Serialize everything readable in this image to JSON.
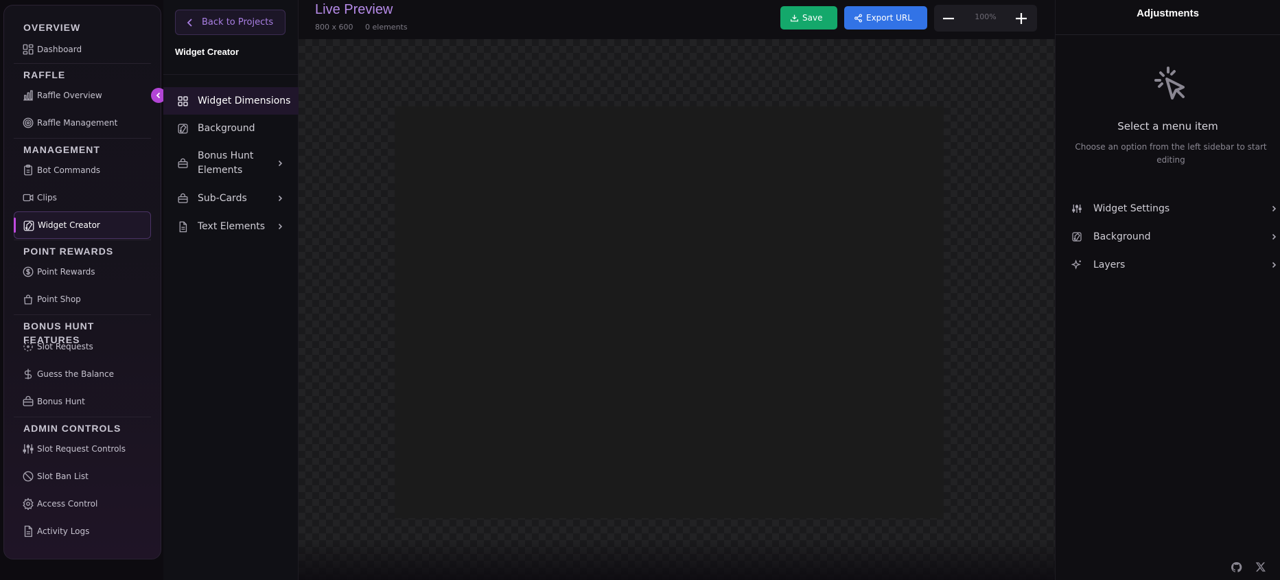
{
  "nav": {
    "sections": [
      {
        "title": "OVERVIEW",
        "items": [
          {
            "label": "Dashboard",
            "icon": "dashboard-icon"
          }
        ]
      },
      {
        "title": "RAFFLE",
        "items": [
          {
            "label": "Raffle Overview",
            "icon": "bar-chart-icon"
          },
          {
            "label": "Raffle Management",
            "icon": "target-icon"
          }
        ]
      },
      {
        "title": "MANAGEMENT",
        "items": [
          {
            "label": "Bot Commands",
            "icon": "clipboard-icon"
          },
          {
            "label": "Clips",
            "icon": "video-icon"
          },
          {
            "label": "Widget Creator",
            "icon": "palette-icon",
            "active": true
          }
        ]
      },
      {
        "title": "POINT REWARDS",
        "items": [
          {
            "label": "Point Rewards",
            "icon": "dollar-circle-icon"
          },
          {
            "label": "Point Shop",
            "icon": "shopping-bag-icon"
          }
        ]
      },
      {
        "title": "BONUS HUNT FEATURES",
        "items": [
          {
            "label": "Slot Requests",
            "icon": "dashed-circle-icon"
          },
          {
            "label": "Guess the Balance",
            "icon": "dollar-icon"
          },
          {
            "label": "Bonus Hunt",
            "icon": "briefcase-icon"
          }
        ]
      },
      {
        "title": "ADMIN CONTROLS",
        "items": [
          {
            "label": "Slot Request Controls",
            "icon": "sliders-icon"
          },
          {
            "label": "Slot Ban List",
            "icon": "ban-icon"
          },
          {
            "label": "Access Control",
            "icon": "gear-icon"
          },
          {
            "label": "Activity Logs",
            "icon": "file-icon"
          }
        ]
      }
    ]
  },
  "editor": {
    "back_label": "Back to Projects",
    "title": "Widget Creator",
    "items": [
      {
        "label": "Widget Dimensions",
        "icon": "grid-icon",
        "active": true,
        "chevron": false
      },
      {
        "label": "Background",
        "icon": "palette-icon",
        "chevron": false
      },
      {
        "label": "Bonus Hunt Elements",
        "label_line1": "Bonus Hunt",
        "label_line2": "Elements",
        "icon": "briefcase-icon",
        "chevron": true
      },
      {
        "label": "Sub-Cards",
        "icon": "briefcase-icon",
        "chevron": true
      },
      {
        "label": "Text Elements",
        "icon": "file-icon",
        "chevron": true
      }
    ]
  },
  "topbar": {
    "title": "Live Preview",
    "size": "800 x 600",
    "count": "0 elements",
    "save_label": "Save",
    "export_label": "Export URL",
    "zoom": "100%"
  },
  "adjustments": {
    "title": "Adjustments",
    "empty_title": "Select a menu item",
    "empty_desc": "Choose an option from the left sidebar to start editing",
    "items": [
      {
        "label": "Widget Settings",
        "icon": "sliders-icon"
      },
      {
        "label": "Background",
        "icon": "palette-icon"
      },
      {
        "label": "Layers",
        "icon": "sparkles-icon"
      }
    ]
  },
  "colors": {
    "accent": "#b245d6",
    "preview_title": "#b68be8",
    "save": "#14a86b",
    "export": "#3273e6"
  }
}
